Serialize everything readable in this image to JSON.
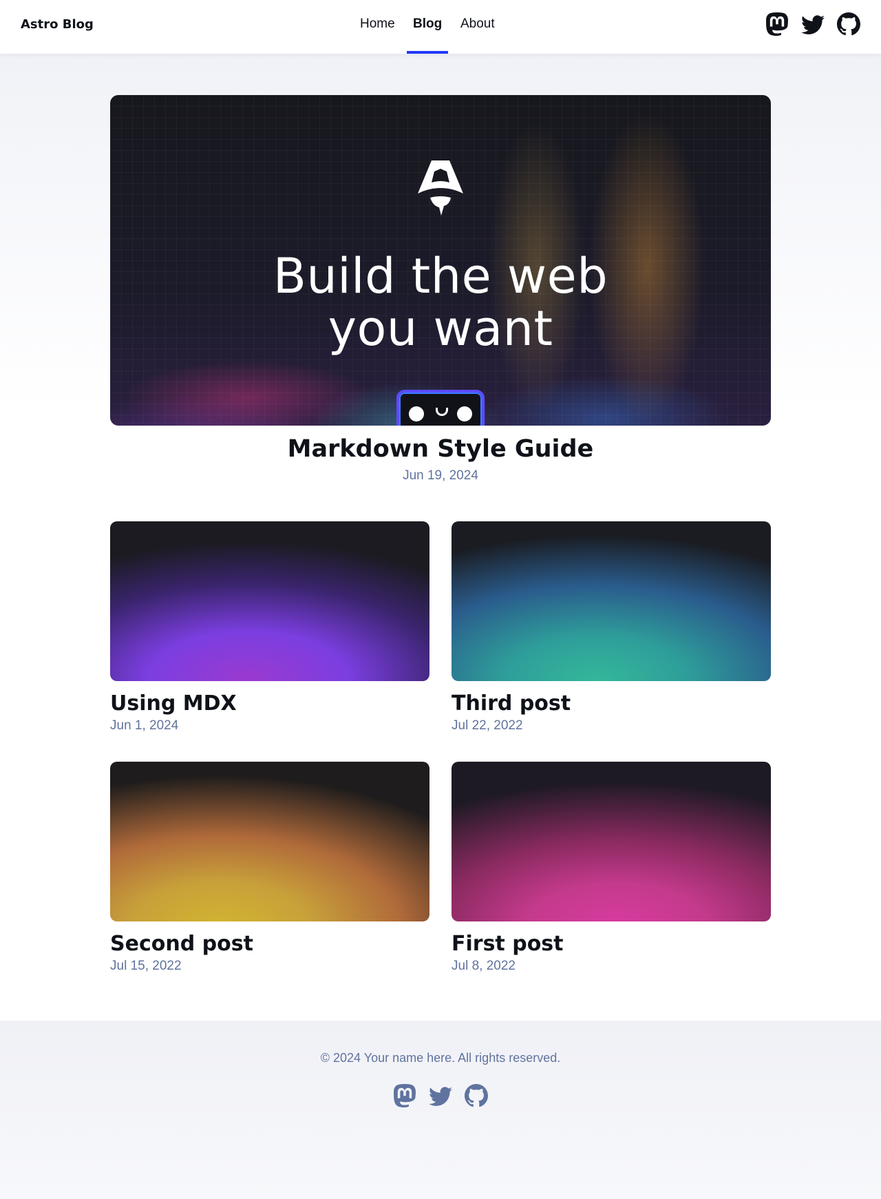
{
  "header": {
    "brand": "Astro Blog",
    "nav": [
      {
        "label": "Home",
        "active": false
      },
      {
        "label": "Blog",
        "active": true
      },
      {
        "label": "About",
        "active": false
      }
    ],
    "social": [
      {
        "icon": "mastodon-icon"
      },
      {
        "icon": "twitter-icon"
      },
      {
        "icon": "github-icon"
      }
    ],
    "accent_color": "#2337ff"
  },
  "hero": {
    "image_headline_line1": "Build the web",
    "image_headline_line2": "you want",
    "title": "Markdown Style Guide",
    "date": "Jun 19, 2024"
  },
  "posts": [
    {
      "title": "Using MDX",
      "date": "Jun 1, 2024"
    },
    {
      "title": "Third post",
      "date": "Jul 22, 2022"
    },
    {
      "title": "Second post",
      "date": "Jul 15, 2022"
    },
    {
      "title": "First post",
      "date": "Jul 8, 2022"
    }
  ],
  "footer": {
    "copyright": "© 2024 Your name here. All rights reserved.",
    "social": [
      {
        "icon": "mastodon-icon"
      },
      {
        "icon": "twitter-icon"
      },
      {
        "icon": "github-icon"
      }
    ]
  }
}
